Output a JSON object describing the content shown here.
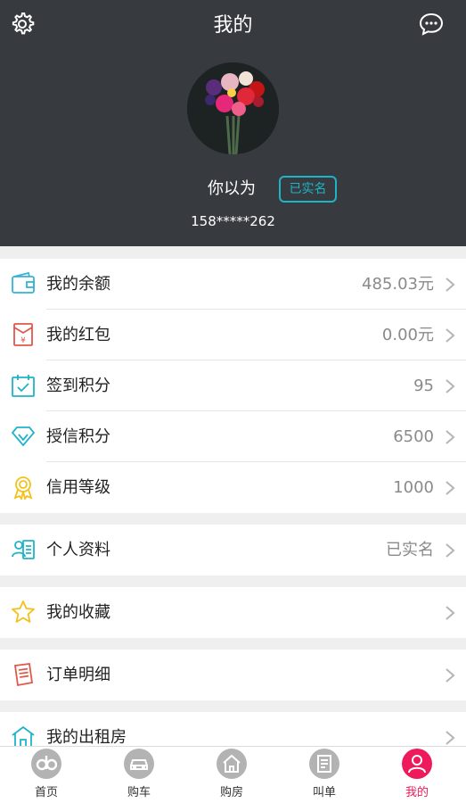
{
  "header": {
    "title": "我的",
    "settings_icon": "gear-icon",
    "message_icon": "chat-bubble-icon"
  },
  "profile": {
    "username": "你以为",
    "verified_badge": "已实名",
    "phone": "158*****262"
  },
  "wallet_items": [
    {
      "label": "我的余额",
      "value": "485.03元",
      "icon": "wallet-icon"
    },
    {
      "label": "我的红包",
      "value": "0.00元",
      "icon": "red-envelope-icon"
    },
    {
      "label": "签到积分",
      "value": "95",
      "icon": "calendar-check-icon"
    },
    {
      "label": "授信积分",
      "value": "6500",
      "icon": "diamond-icon"
    },
    {
      "label": "信用等级",
      "value": "1000",
      "icon": "medal-icon"
    }
  ],
  "profile_item": {
    "label": "个人资料",
    "value": "已实名",
    "icon": "id-card-icon"
  },
  "favorites_item": {
    "label": "我的收藏",
    "value": "",
    "icon": "star-icon"
  },
  "orders_item": {
    "label": "订单明细",
    "value": "",
    "icon": "receipt-icon"
  },
  "rentals_item": {
    "label": "我的出租房",
    "value": "",
    "icon": "house-icon"
  },
  "tabbar": [
    {
      "label": "首页",
      "icon": "home-logo-icon",
      "active": false
    },
    {
      "label": "购车",
      "icon": "car-icon",
      "active": false
    },
    {
      "label": "购房",
      "icon": "house-icon",
      "active": false
    },
    {
      "label": "叫单",
      "icon": "document-icon",
      "active": false
    },
    {
      "label": "我的",
      "icon": "user-icon",
      "active": true
    }
  ],
  "colors": {
    "header_bg": "#373b40",
    "accent_teal": "#1eb4c8",
    "active_pink": "#ee1a5b"
  }
}
